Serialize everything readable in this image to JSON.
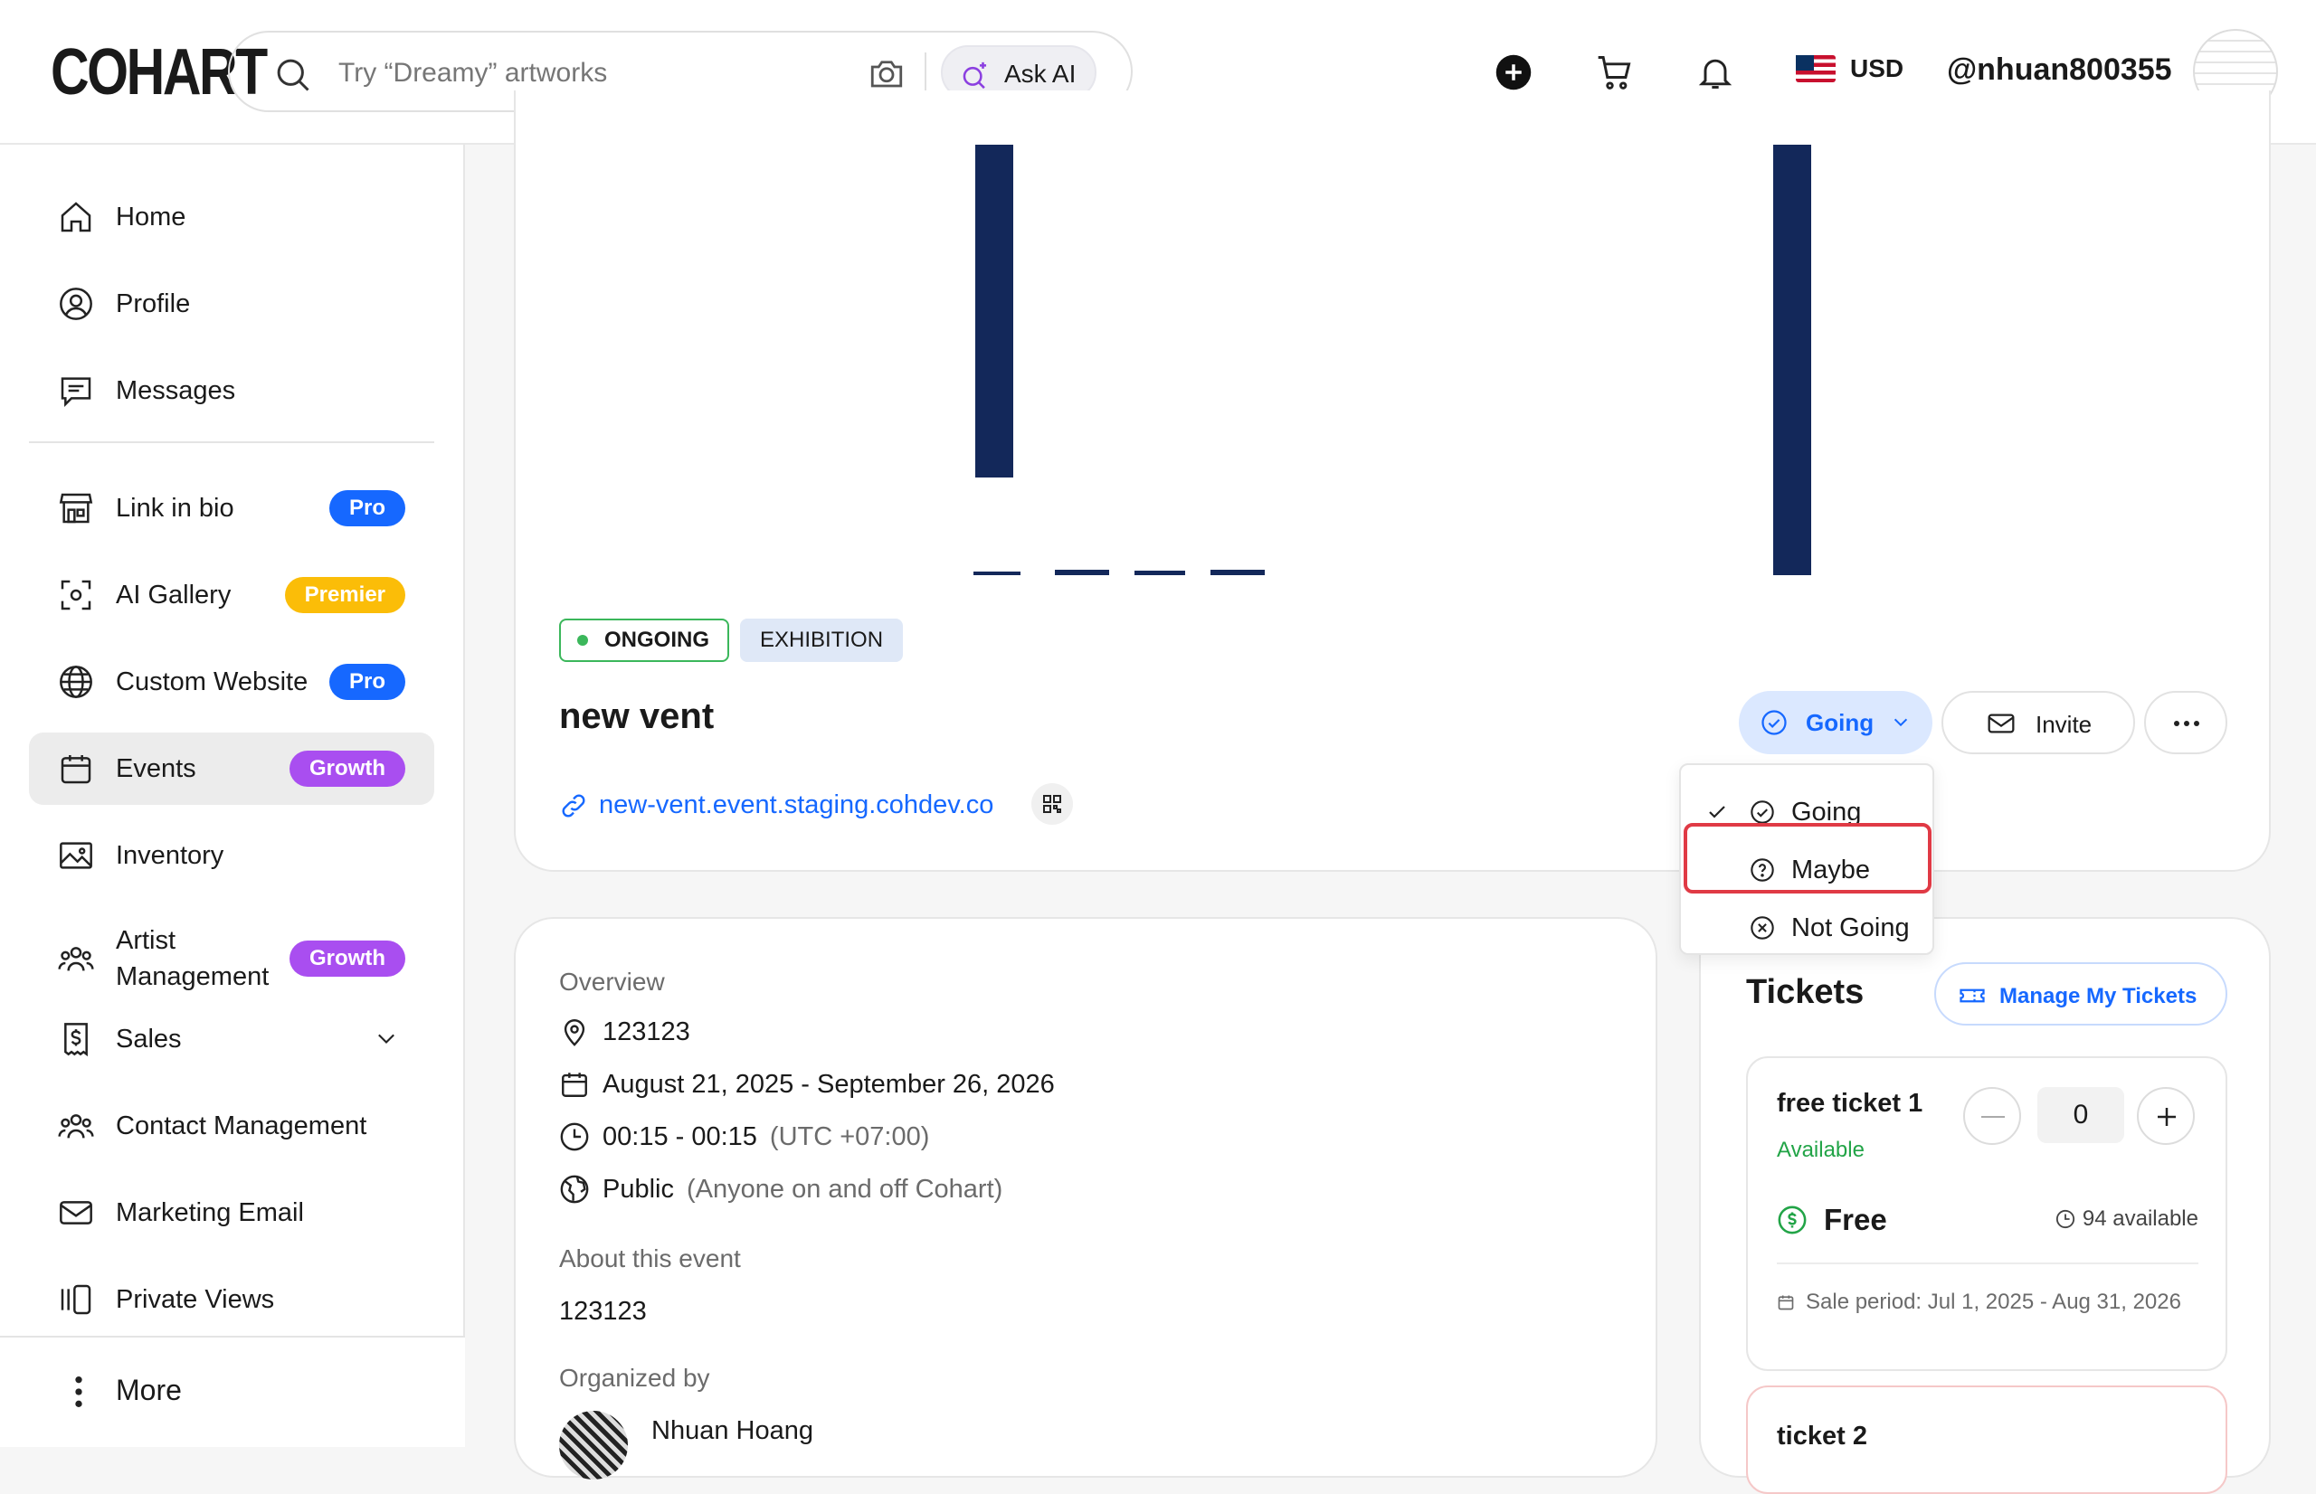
{
  "header": {
    "logo": "COHART",
    "search_placeholder": "Try “Dreamy” artworks",
    "ask_ai": "Ask AI",
    "currency": "USD",
    "username": "@nhuan800355"
  },
  "sidebar": {
    "items": [
      {
        "label": "Home"
      },
      {
        "label": "Profile"
      },
      {
        "label": "Messages"
      },
      {
        "label": "Link in bio",
        "badge": "Pro"
      },
      {
        "label": "AI Gallery",
        "badge": "Premier"
      },
      {
        "label": "Custom Website",
        "badge": "Pro"
      },
      {
        "label": "Events",
        "badge": "Growth"
      },
      {
        "label": "Inventory"
      },
      {
        "label": "Artist Management",
        "badge": "Growth"
      },
      {
        "label": "Sales"
      },
      {
        "label": "Contact Management"
      },
      {
        "label": "Marketing Email"
      },
      {
        "label": "Private Views"
      }
    ],
    "more": "More"
  },
  "event": {
    "status_tag": "ONGOING",
    "type_tag": "EXHIBITION",
    "title": "new vent",
    "link": "new-vent.event.staging.cohdev.co",
    "rsvp_button": "Going",
    "invite_button": "Invite",
    "rsvp_options": [
      "Going",
      "Maybe",
      "Not Going"
    ],
    "rsvp_selected": "Going",
    "rsvp_hovered": "Maybe"
  },
  "overview": {
    "heading": "Overview",
    "location": "123123",
    "dates": "August 21, 2025 - September 26, 2026",
    "time": "00:15 - 00:15",
    "timezone": "(UTC +07:00)",
    "visibility": "Public",
    "visibility_note": "(Anyone on and off Cohart)",
    "about_heading": "About this event",
    "about_text": "123123",
    "organized_heading": "Organized by",
    "organizer": "Nhuan Hoang"
  },
  "tickets": {
    "heading": "Tickets",
    "manage_button": "Manage My Tickets",
    "items": [
      {
        "name": "free ticket 1",
        "status": "Available",
        "quantity": "0",
        "price": "Free",
        "available": "94 available",
        "sale_period": "Sale period: Jul 1, 2025 - Aug 31, 2026"
      },
      {
        "name": "ticket 2"
      }
    ]
  },
  "colors": {
    "brand_blue": "#1668ff",
    "pro_badge": "#1668ff",
    "premier_badge": "#fbbd08",
    "growth_badge": "#a94ef0",
    "ongoing_green": "#3bb75b",
    "highlight_red": "#e03a45",
    "banner_navy": "#13285a"
  }
}
